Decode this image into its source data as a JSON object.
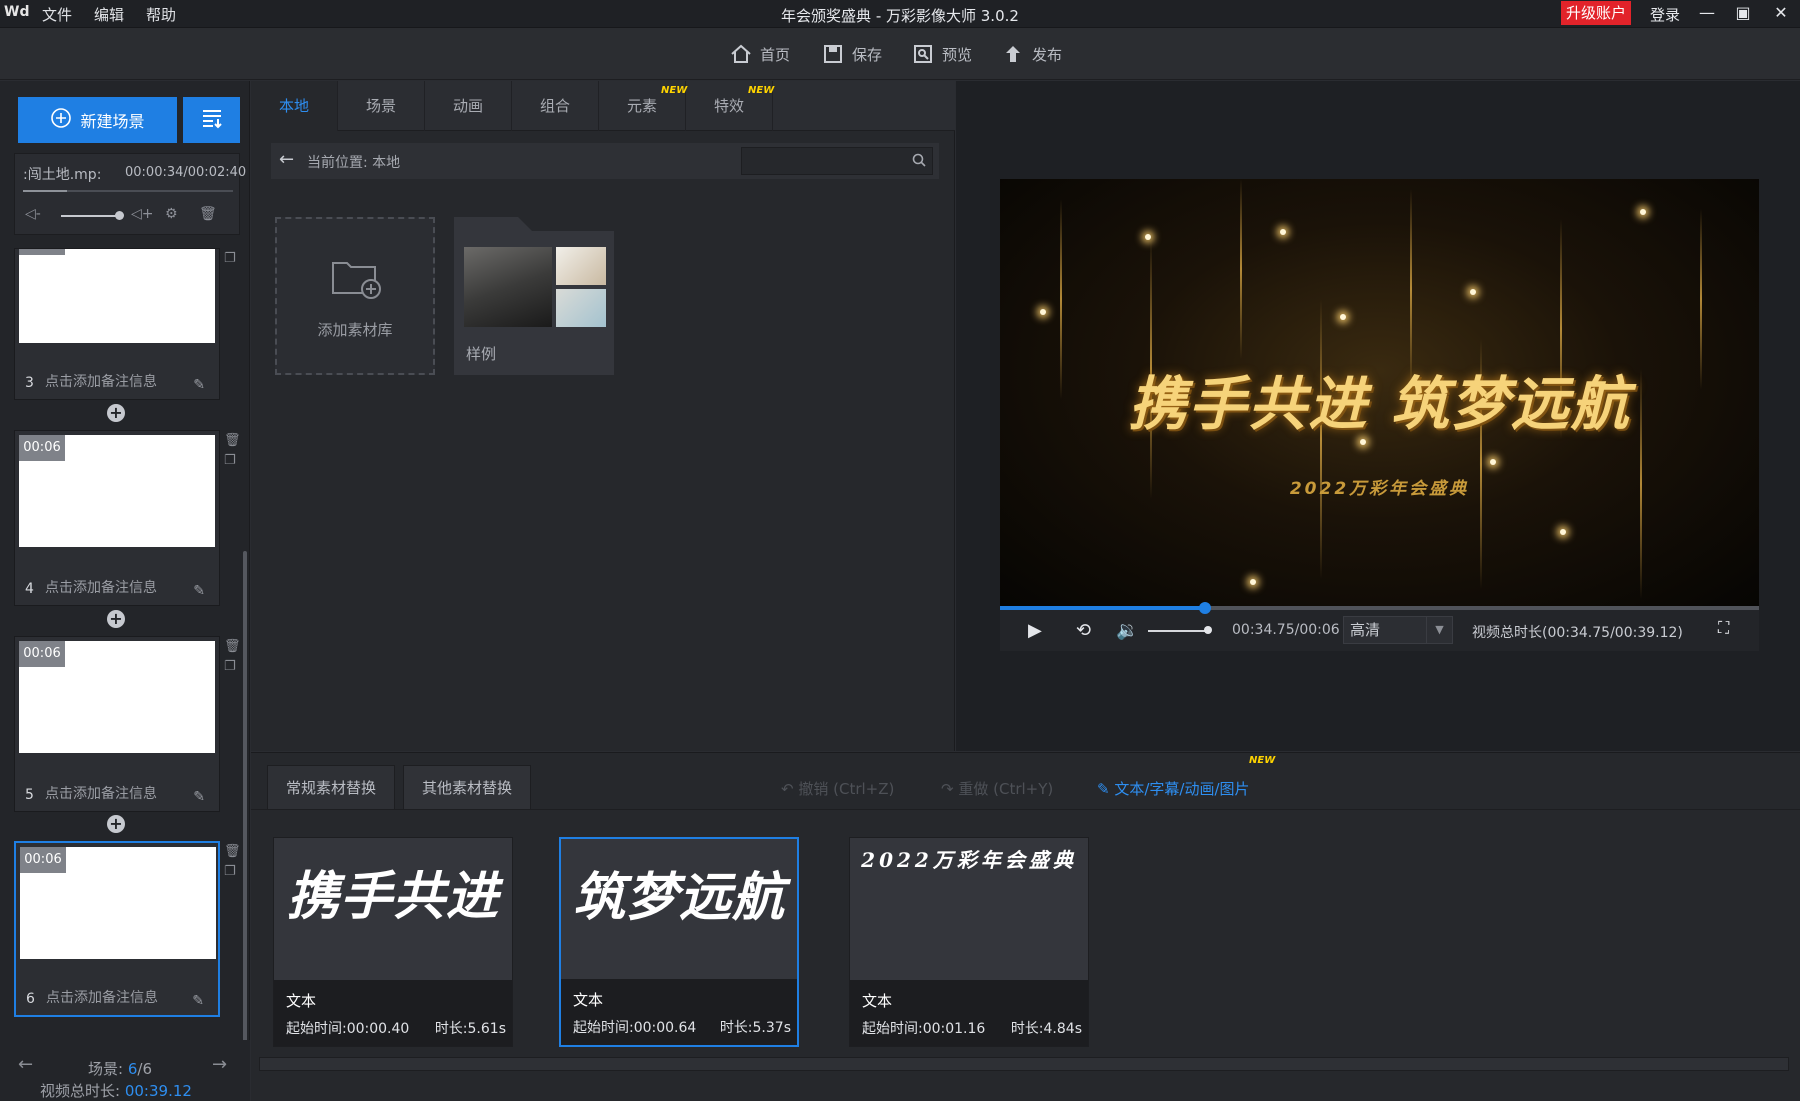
{
  "titlebar": {
    "logo": "Wd",
    "menus": [
      "文件",
      "编辑",
      "帮助"
    ],
    "title": "年会颁奖盛典 - 万彩影像大师 3.0.2",
    "upgrade": "升级账户",
    "login": "登录"
  },
  "toolbar": {
    "home": "首页",
    "save": "保存",
    "preview": "预览",
    "publish": "发布"
  },
  "left": {
    "new_scene": "新建场景",
    "audio_name": ":闯土地.mp:",
    "audio_time": "00:00:34/00:02:40",
    "audio_progress": 0.21,
    "scenes": [
      {
        "num": "3",
        "duration": "",
        "note": "点击添加备注信息"
      },
      {
        "num": "4",
        "duration": "00:06",
        "note": "点击添加备注信息"
      },
      {
        "num": "5",
        "duration": "00:06",
        "note": "点击添加备注信息"
      },
      {
        "num": "6",
        "duration": "00:06",
        "note": "点击添加备注信息"
      }
    ],
    "footer_scene_label": "场景:",
    "footer_scene_current": "6",
    "footer_scene_total": "/6",
    "footer_total_label": "视频总时长:",
    "footer_total_value": "00:39.12"
  },
  "library": {
    "tabs": [
      "本地",
      "场景",
      "动画",
      "组合",
      "元素",
      "特效"
    ],
    "new_badge": "NEW",
    "path_label": "当前位置:  本地",
    "search_placeholder": "",
    "add_library": "添加素材库",
    "sample_label": "样例"
  },
  "preview": {
    "video_title": "携手共进  筑梦远航",
    "video_subtitle": "2022万彩年会盛典",
    "time_readout": "00:34.75/00:06",
    "quality": "高清",
    "total_label": "视频总时长(00:34.75/00:39.12)",
    "progress": 0.27
  },
  "bottom": {
    "tab_regular": "常规素材替换",
    "tab_other": "其他素材替换",
    "undo": "撤销 (Ctrl+Z)",
    "redo": "重做 (Ctrl+Y)",
    "text_link": "文本/字幕/动画/图片",
    "new_badge": "NEW",
    "cards": [
      {
        "text": "携手共进",
        "type": "文本",
        "start": "起始时间:00:00.40",
        "duration": "时长:5.61s"
      },
      {
        "text": "筑梦远航",
        "type": "文本",
        "start": "起始时间:00:00.64",
        "duration": "时长:5.37s"
      },
      {
        "text": "2022万彩年会盛典",
        "type": "文本",
        "start": "起始时间:00:01.16",
        "duration": "时长:4.84s"
      }
    ]
  },
  "icons": {
    "home": "home-icon",
    "save": "save-icon",
    "preview": "preview-icon",
    "publish": "publish-icon"
  },
  "colors": {
    "accent": "#1f7fe3",
    "upgrade": "#e2232a",
    "new_badge": "#ffd400"
  }
}
